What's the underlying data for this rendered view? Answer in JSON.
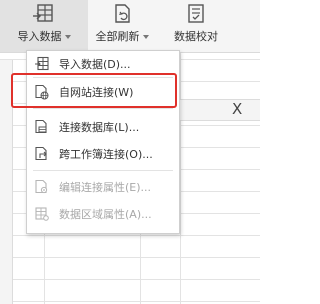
{
  "ribbon": {
    "import_data": {
      "label": "导入数据",
      "icon": "import-data-icon"
    },
    "refresh_all": {
      "label": "全部刷新",
      "icon": "refresh-all-icon"
    },
    "data_verify": {
      "label": "数据校对",
      "icon": "data-verify-icon"
    }
  },
  "grid": {
    "column_letter": "X"
  },
  "menu": {
    "items": [
      {
        "label": "导入数据(D)...",
        "icon": "import-data-icon",
        "enabled": true
      },
      {
        "label": "自网站连接(W)",
        "icon": "web-connection-icon",
        "enabled": true,
        "highlighted": true
      },
      {
        "label": "连接数据库(L)...",
        "icon": "database-connection-icon",
        "enabled": true
      },
      {
        "label": "跨工作簿连接(O)...",
        "icon": "workbook-connection-icon",
        "enabled": true
      },
      {
        "label": "编辑连接属性(E)...",
        "icon": "edit-connection-icon",
        "enabled": false
      },
      {
        "label": "数据区域属性(A)...",
        "icon": "range-properties-icon",
        "enabled": false
      }
    ]
  },
  "colors": {
    "highlight_border": "#e0312b",
    "disabled_text": "#a8a8a8"
  }
}
